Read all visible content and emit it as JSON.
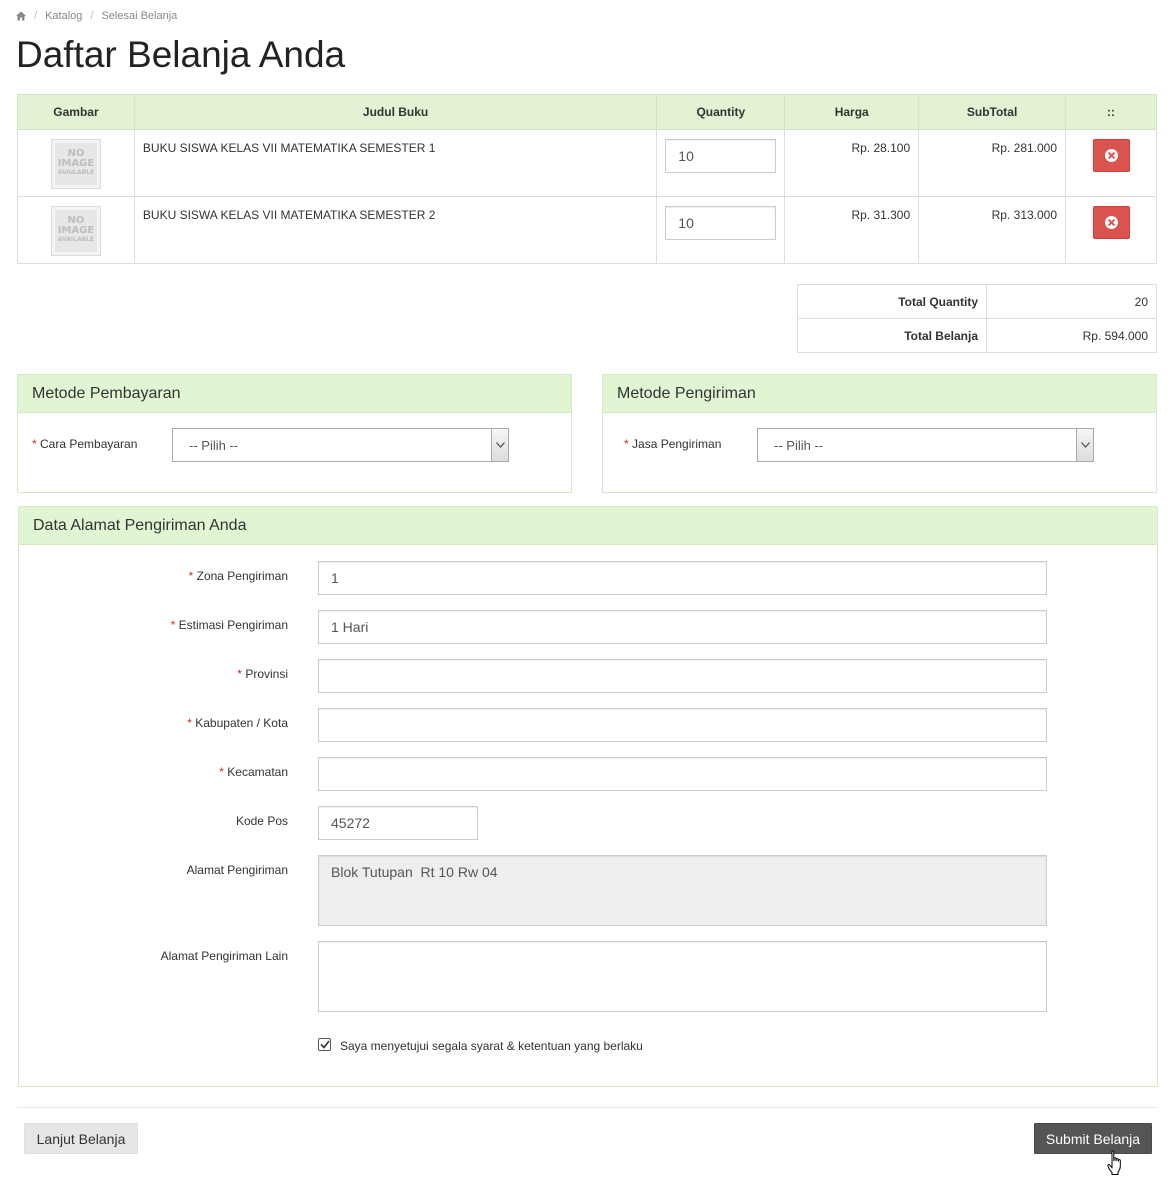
{
  "breadcrumb": {
    "home_icon": "home-icon",
    "items": [
      "Katalog",
      "Selesai Belanja"
    ],
    "separator": "/"
  },
  "page_title": "Daftar Belanja Anda",
  "cart": {
    "headers": [
      "Gambar",
      "Judul Buku",
      "Quantity",
      "Harga",
      "SubTotal",
      "::"
    ],
    "no_image_text": [
      "NO",
      "IMAGE",
      "AVAILABLE"
    ],
    "rows": [
      {
        "title": "BUKU SISWA KELAS VII MATEMATIKA SEMESTER 1",
        "quantity": "10",
        "price": "Rp. 28.100",
        "subtotal": "Rp. 281.000",
        "action_icon": "remove-icon"
      },
      {
        "title": "BUKU SISWA KELAS VII MATEMATIKA SEMESTER 2",
        "quantity": "10",
        "price": "Rp. 31.300",
        "subtotal": "Rp. 313.000",
        "action_icon": "remove-icon"
      }
    ]
  },
  "totals": {
    "quantity_label": "Total Quantity",
    "quantity_value": "20",
    "amount_label": "Total Belanja",
    "amount_value": "Rp. 594.000"
  },
  "payment": {
    "heading": "Metode Pembayaran",
    "label": "Cara Pembayaran",
    "selected": "-- Pilih --"
  },
  "shipping": {
    "heading": "Metode Pengiriman",
    "label": "Jasa Pengiriman",
    "selected": "-- Pilih --"
  },
  "address": {
    "heading": "Data Alamat Pengiriman Anda",
    "required_mark": "*",
    "zona_label": "Zona Pengiriman",
    "zona_value": "1",
    "estimasi_label": "Estimasi Pengiriman",
    "estimasi_value": "1 Hari",
    "provinsi_label": "Provinsi",
    "provinsi_value": "",
    "kabupaten_label": "Kabupaten / Kota",
    "kabupaten_value": "",
    "kecamatan_label": "Kecamatan",
    "kecamatan_value": "",
    "kodepos_label": "Kode Pos",
    "kodepos_value": "45272",
    "alamat_label": "Alamat Pengiriman",
    "alamat_value": "Blok Tutupan  Rt 10 Rw 04",
    "alamat_lain_label": "Alamat Pengiriman Lain",
    "alamat_lain_value": "",
    "agree_label": "Saya menyetujui segala syarat & ketentuan yang berlaku",
    "agree_checked": true
  },
  "actions": {
    "continue_label": "Lanjut Belanja",
    "submit_label": "Submit Belanja"
  },
  "colors": {
    "header_green": "#e2f2d3",
    "danger": "#d9534f",
    "dark_button": "#555555",
    "required": "#c9302c"
  }
}
